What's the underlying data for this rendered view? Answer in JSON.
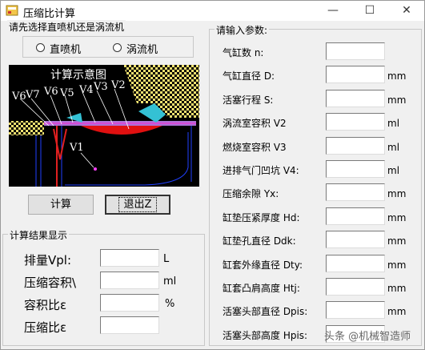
{
  "window": {
    "title": "压缩比计算",
    "minimize": "—",
    "maximize": "☐",
    "close": "✕"
  },
  "engine_select": {
    "group_label": "请先选择直喷机还是涡流机",
    "options": [
      {
        "label": "直喷机",
        "selected": false
      },
      {
        "label": "涡流机",
        "selected": false
      }
    ]
  },
  "diagram": {
    "title": "计算示意图",
    "labels": {
      "v6": "V6",
      "v7": "V7",
      "v6b": "V6",
      "v5": "V5",
      "v4": "V4",
      "v3": "V3",
      "v2": "V2",
      "v1": "V1"
    }
  },
  "buttons": {
    "calculate": "计算",
    "exit": "退出Z"
  },
  "results": {
    "group_label": "计算结果显示",
    "rows": [
      {
        "label": "排量Vpl:",
        "value": "",
        "unit": "L"
      },
      {
        "label": "压缩容积\\",
        "value": "",
        "unit": "ml"
      },
      {
        "label": "容积比ε",
        "value": "",
        "unit": "%"
      },
      {
        "label": "压缩比ε",
        "value": "",
        "unit": ""
      }
    ]
  },
  "params": {
    "group_label": "请输入参数:",
    "rows": [
      {
        "label": "气缸数 n:",
        "value": "",
        "unit": ""
      },
      {
        "label": "气缸直径 D:",
        "value": "",
        "unit": "mm"
      },
      {
        "label": "活塞行程 S:",
        "value": "",
        "unit": "mm"
      },
      {
        "label": "涡流室容积 V2",
        "value": "",
        "unit": "ml"
      },
      {
        "label": "燃烧室容积 V3",
        "value": "",
        "unit": "ml"
      },
      {
        "label": "进排气门凹坑 V4:",
        "value": "",
        "unit": "ml"
      },
      {
        "label": "压缩余隙 Yx:",
        "value": "",
        "unit": "mm"
      },
      {
        "label": "缸垫压紧厚度 Hd:",
        "value": "",
        "unit": "mm"
      },
      {
        "label": "缸垫孔直径 Ddk:",
        "value": "",
        "unit": "mm"
      },
      {
        "label": "缸套外缘直径 Dty:",
        "value": "",
        "unit": "mm"
      },
      {
        "label": "缸套凸肩高度 Htj:",
        "value": "",
        "unit": "mm"
      },
      {
        "label": "活塞头部直径 Dpis:",
        "value": "",
        "unit": "mm"
      },
      {
        "label": "活塞头部高度 Hpis:",
        "value": "",
        "unit": ""
      }
    ]
  },
  "watermark": "头条 @机械智造师"
}
